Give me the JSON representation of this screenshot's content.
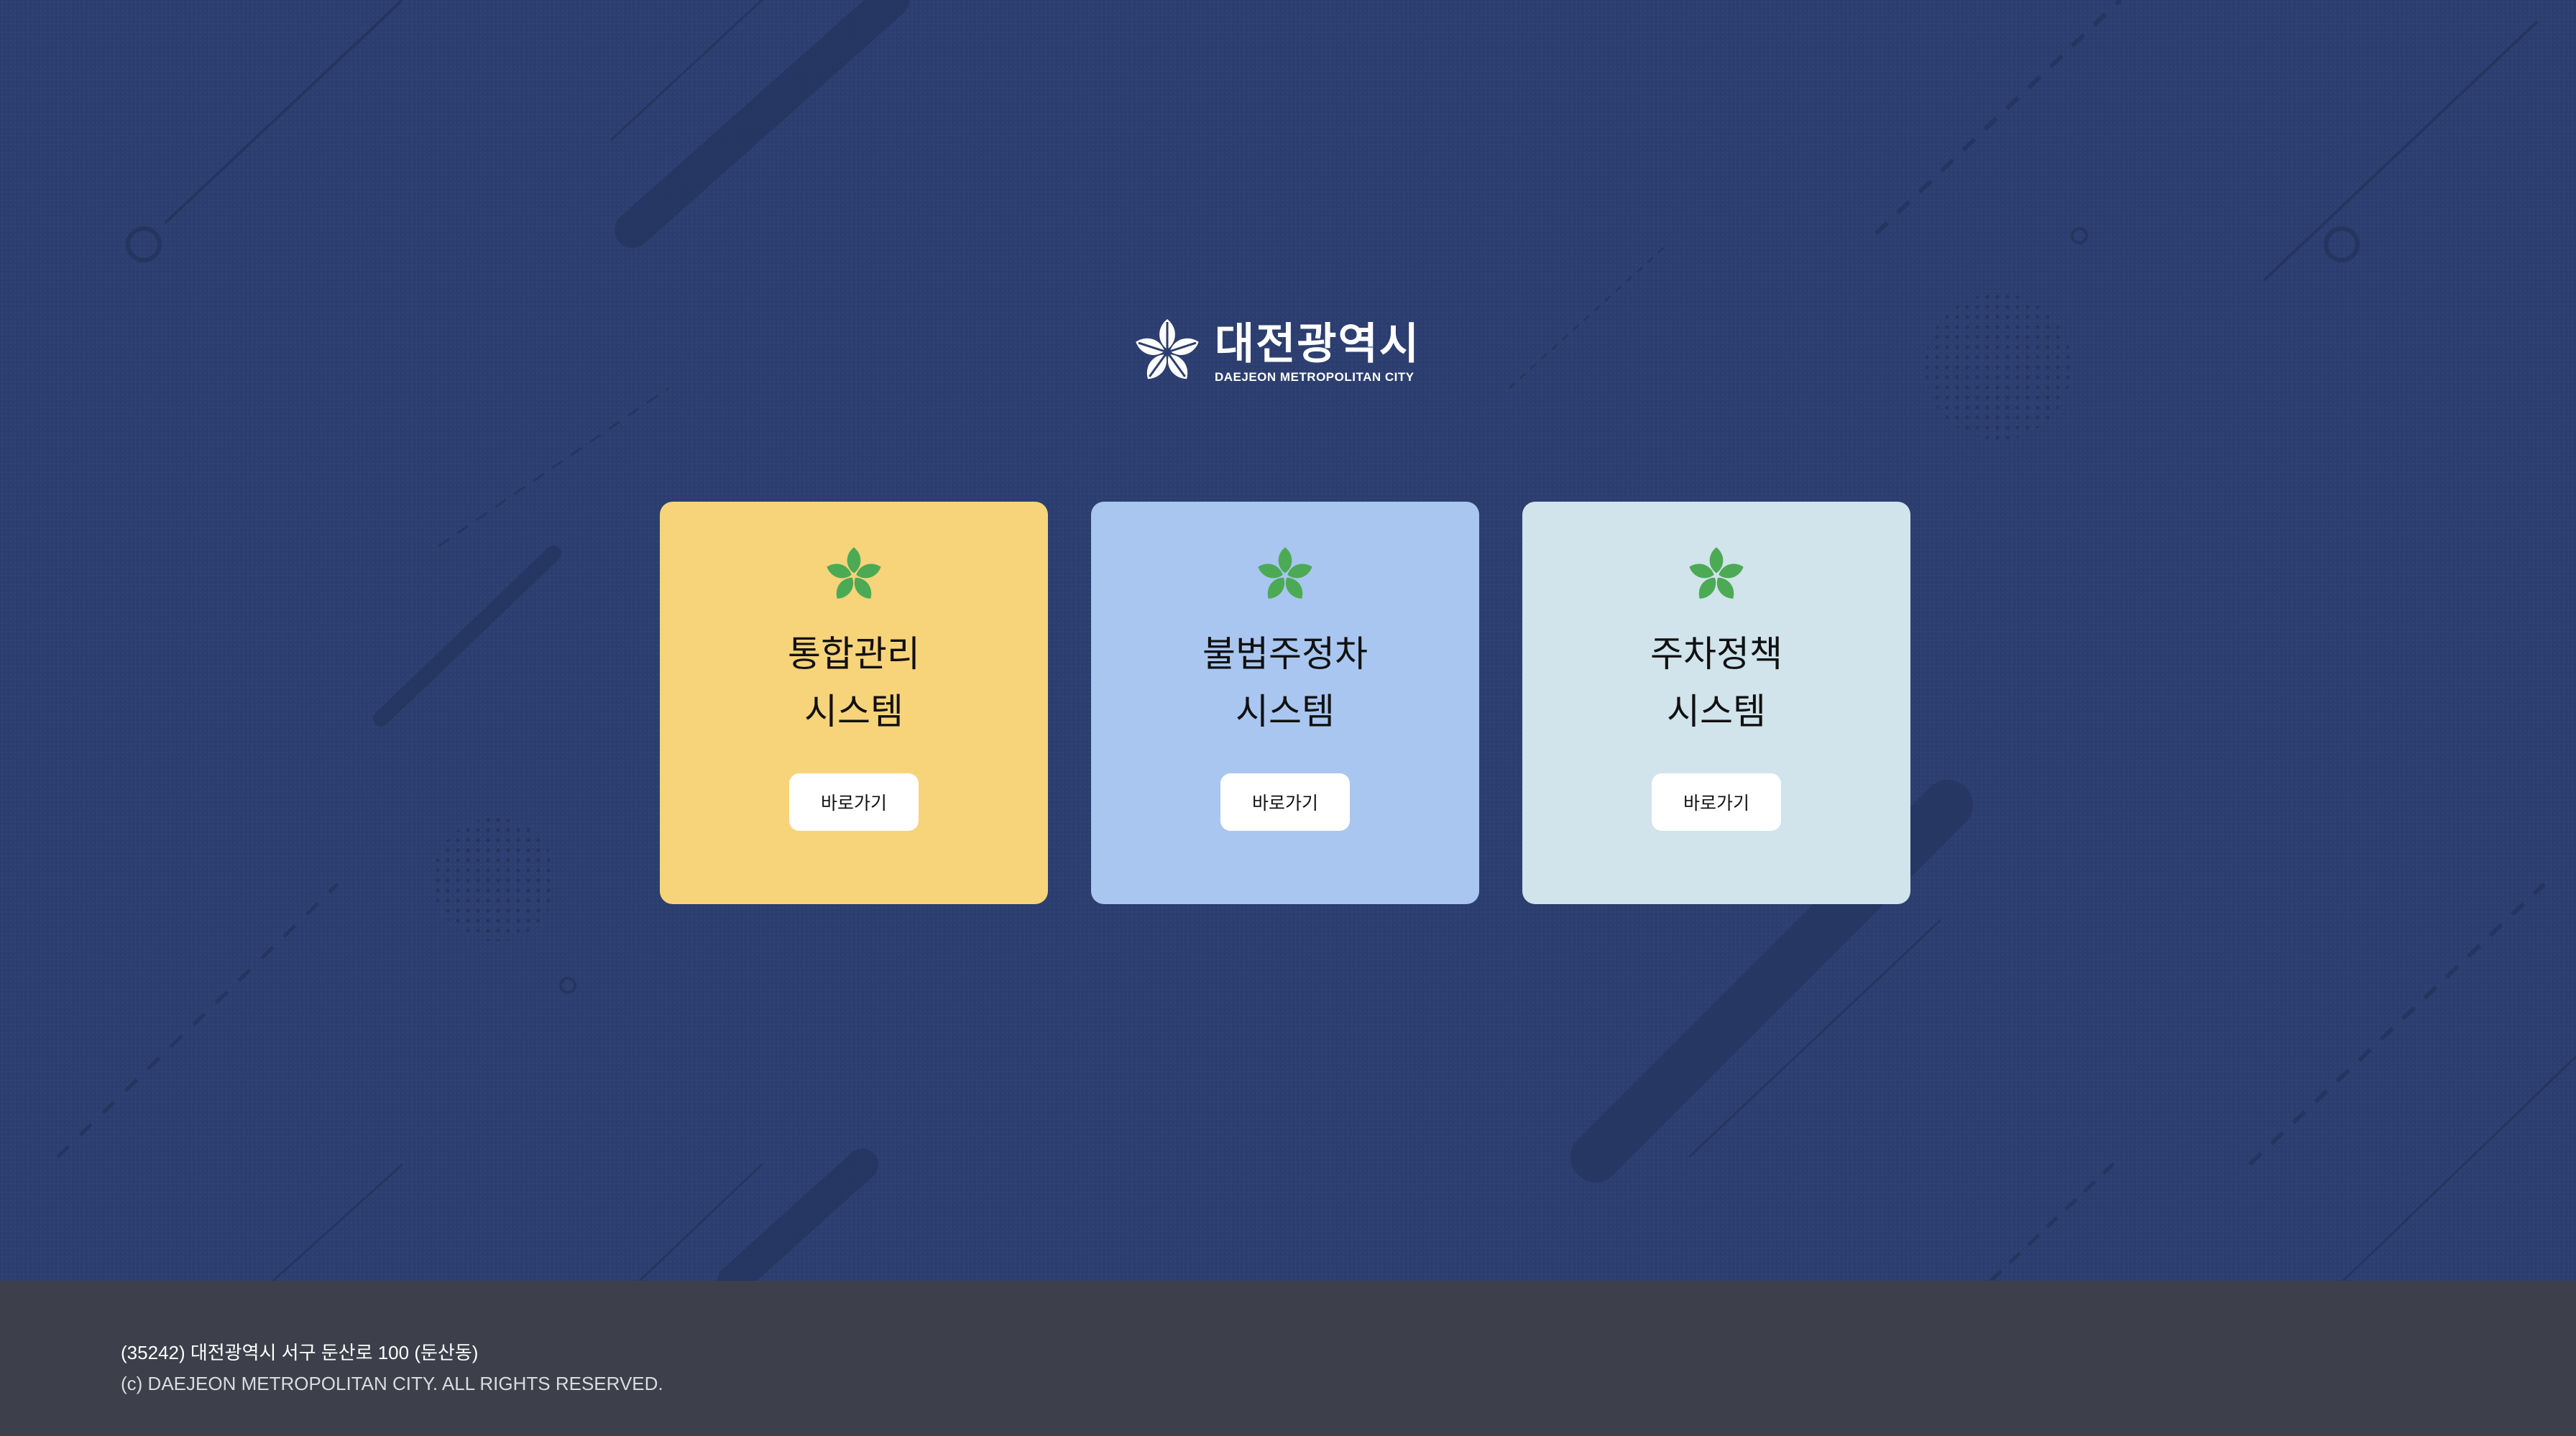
{
  "logo": {
    "title_ko": "대전광역시",
    "title_en": "DAEJEON METROPOLITAN CITY",
    "mark_icon": "daejeon-symbol-icon"
  },
  "cards": [
    {
      "title_line1": "통합관리",
      "title_line2": "시스템",
      "button_label": "바로가기",
      "color": "#f7d37a",
      "icon": "daejeon-symbol-icon"
    },
    {
      "title_line1": "불법주정차",
      "title_line2": "시스템",
      "button_label": "바로가기",
      "color": "#a8c6f0",
      "icon": "daejeon-symbol-icon"
    },
    {
      "title_line1": "주차정책",
      "title_line2": "시스템",
      "button_label": "바로가기",
      "color": "#d1e3eb",
      "icon": "daejeon-symbol-icon"
    }
  ],
  "footer": {
    "address": "(35242) 대전광역시 서구 둔산로 100 (둔산동)",
    "copyright": "(c) DAEJEON METROPOLITAN CITY. ALL RIGHTS RESERVED."
  },
  "colors": {
    "background": "#2c3e6f",
    "footer": "#3d404b",
    "symbol_green": "#4caa55"
  }
}
